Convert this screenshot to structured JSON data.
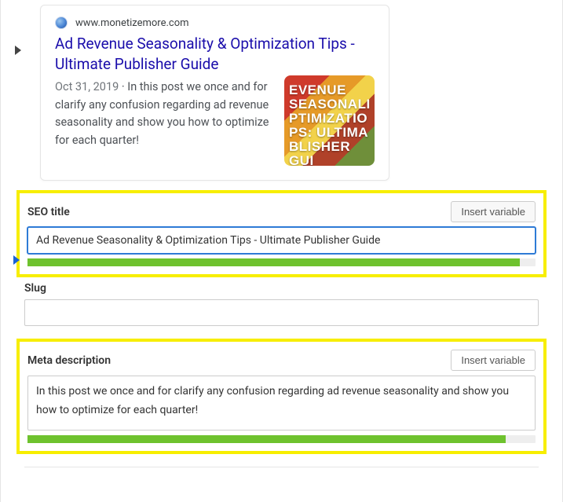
{
  "serp": {
    "domain": "www.monetizemore.com",
    "title": "Ad Revenue Seasonality & Optimization Tips - Ultimate Publisher Guide",
    "date": "Oct 31, 2019",
    "separator": " · ",
    "snippet": "In this post we once and for clarify any confusion regarding ad revenue seasonality and show you how to optimize for each quarter!",
    "thumb_text": "EVENUE SEASONALI\nPTIMIZATIO\nPS: ULTIMA\nBLISHER GUI"
  },
  "fields": {
    "seo_title": {
      "label": "SEO title",
      "insert_button": "Insert variable",
      "value": "Ad Revenue Seasonality & Optimization Tips - Ultimate Publisher Guide"
    },
    "slug": {
      "label": "Slug",
      "value": ""
    },
    "meta_description": {
      "label": "Meta description",
      "insert_button": "Insert variable",
      "value": "In this post we once and for clarify any confusion regarding ad revenue seasonality and show you how to optimize for each quarter!"
    }
  }
}
